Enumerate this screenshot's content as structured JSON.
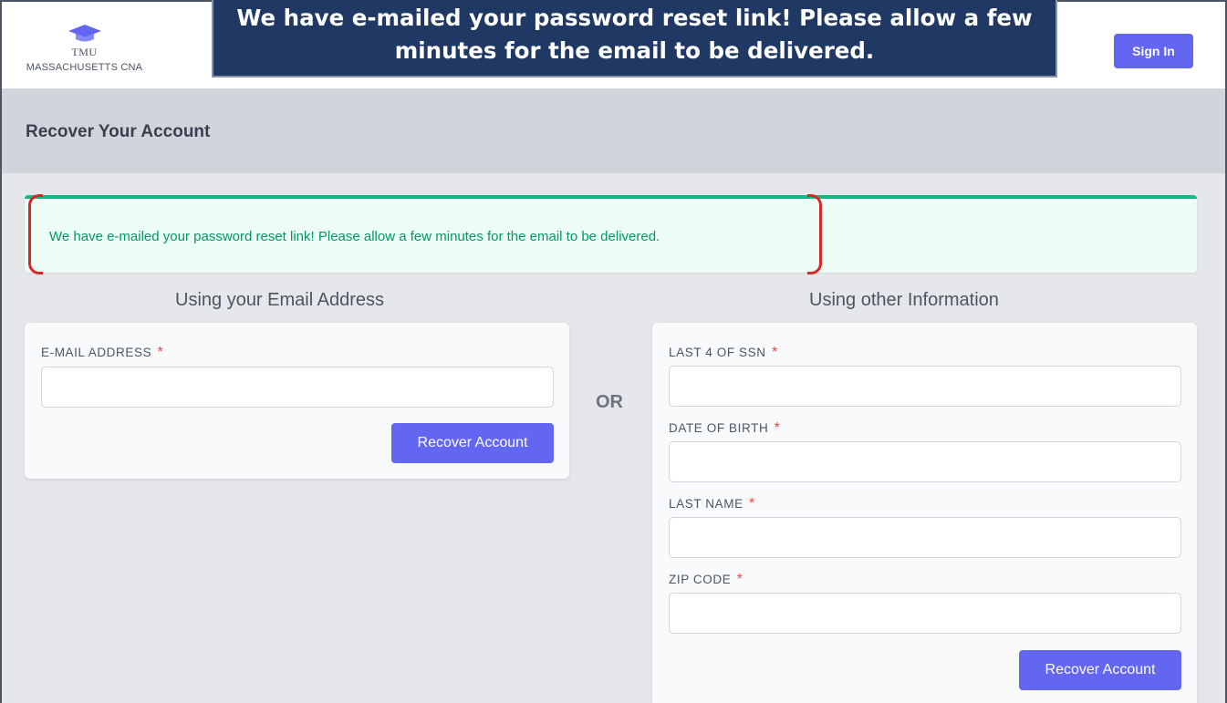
{
  "brand": {
    "abbr": "TMU",
    "name": "MASSACHUSETTS CNA",
    "icon": "graduation-cap-icon",
    "icon_color": "#6366f1"
  },
  "nav": {
    "signin_label": "Sign In"
  },
  "callout": {
    "line1": "We have e-mailed your password reset link!  Please allow a few",
    "line2": "minutes for the email to be delivered."
  },
  "page": {
    "title": "Recover Your Account"
  },
  "alert": {
    "message": "We have e-mailed your password reset link! Please allow a few minutes for the email to be delivered.",
    "color": "#10b981"
  },
  "email_section": {
    "title": "Using your Email Address",
    "email_label": "E-MAIL ADDRESS",
    "email_value": "",
    "submit_label": "Recover Account"
  },
  "divider": {
    "label": "OR"
  },
  "info_section": {
    "title": "Using other Information",
    "fields": [
      {
        "label": "LAST 4 OF SSN",
        "value": ""
      },
      {
        "label": "DATE OF BIRTH",
        "value": ""
      },
      {
        "label": "LAST NAME",
        "value": ""
      },
      {
        "label": "ZIP CODE",
        "value": ""
      }
    ],
    "submit_label": "Recover Account"
  },
  "required_marker": "*",
  "colors": {
    "accent": "#6366f1",
    "success": "#059669",
    "required": "#ef4444",
    "callout_bg": "#1f3864",
    "annotation": "#dc2626"
  }
}
